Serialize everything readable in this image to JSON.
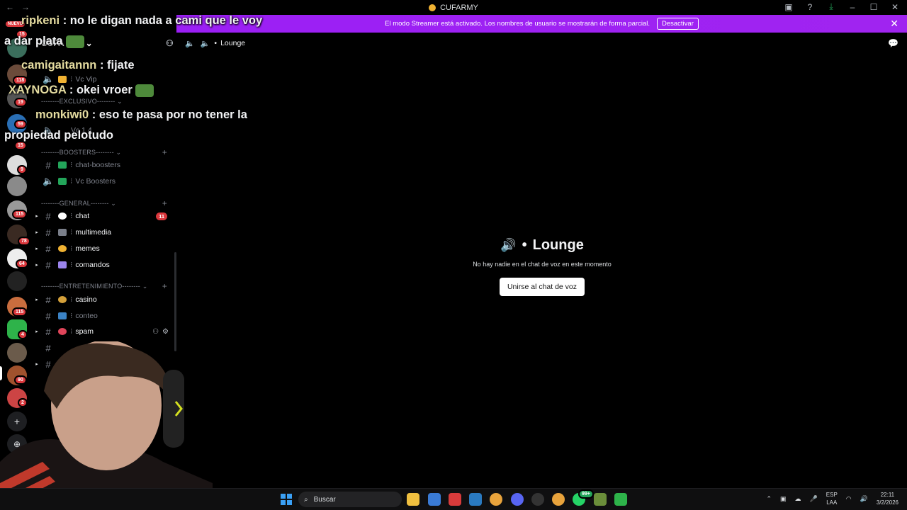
{
  "window": {
    "title": "CUFARMY"
  },
  "banner": {
    "text": "El modo Streamer está activado. Los nombres de usuario se mostrarán de forma parcial.",
    "button": "Desactivar"
  },
  "rail": {
    "new_label": "NUEVO",
    "badges": [
      "15",
      "118",
      "19",
      "59",
      "15",
      "9",
      "115",
      "78",
      "64",
      "115",
      "4",
      "90",
      "2"
    ]
  },
  "overlay": {
    "lines": [
      {
        "nick": "ripkeni",
        "text": " : no le digan nada a cami que le voy"
      },
      {
        "nick": "",
        "text": "a dar plata"
      },
      {
        "nick": "camigaitannn",
        "text": " : fijate"
      },
      {
        "nick": "XAYNOGA",
        "text": " : okei vroer"
      },
      {
        "nick": "monkiwi0",
        "text": " : eso te pasa por no tener la"
      },
      {
        "nick": "",
        "text": "propiedad pelotudo"
      }
    ]
  },
  "sidebar": {
    "server_name": "CUFA",
    "vc_vip": "Vc Vip",
    "cat_exclusivo": "--------EXCLUSIVO--------",
    "vc_partial": "Vc 1 4",
    "cat_boosters": "--------BOOSTERS--------",
    "chat_boosters": "chat-boosters",
    "vc_boosters": "Vc Boosters",
    "cat_general": "--------GENERAL--------",
    "chat": "chat",
    "chat_mentions": "11",
    "multimedia": "multimedia",
    "memes": "memes",
    "comandos": "comandos",
    "cat_entret": "--------ENTRETENIMIENTO--------",
    "casino": "casino",
    "conteo": "conteo",
    "spam": "spam"
  },
  "main": {
    "channel_name": "Lounge",
    "voice_title": "Lounge",
    "voice_empty": "No hay nadie en el chat de voz en este momento",
    "join_button": "Unirse al chat de voz"
  },
  "taskbar": {
    "search": "Buscar",
    "lang_top": "ESP",
    "lang_bottom": "LAA",
    "time": "22:11",
    "date": "3/2/2026",
    "notif": "99+"
  },
  "colors": {
    "banner": "#a01ff0",
    "mention": "#da373c",
    "background": "#000000"
  }
}
